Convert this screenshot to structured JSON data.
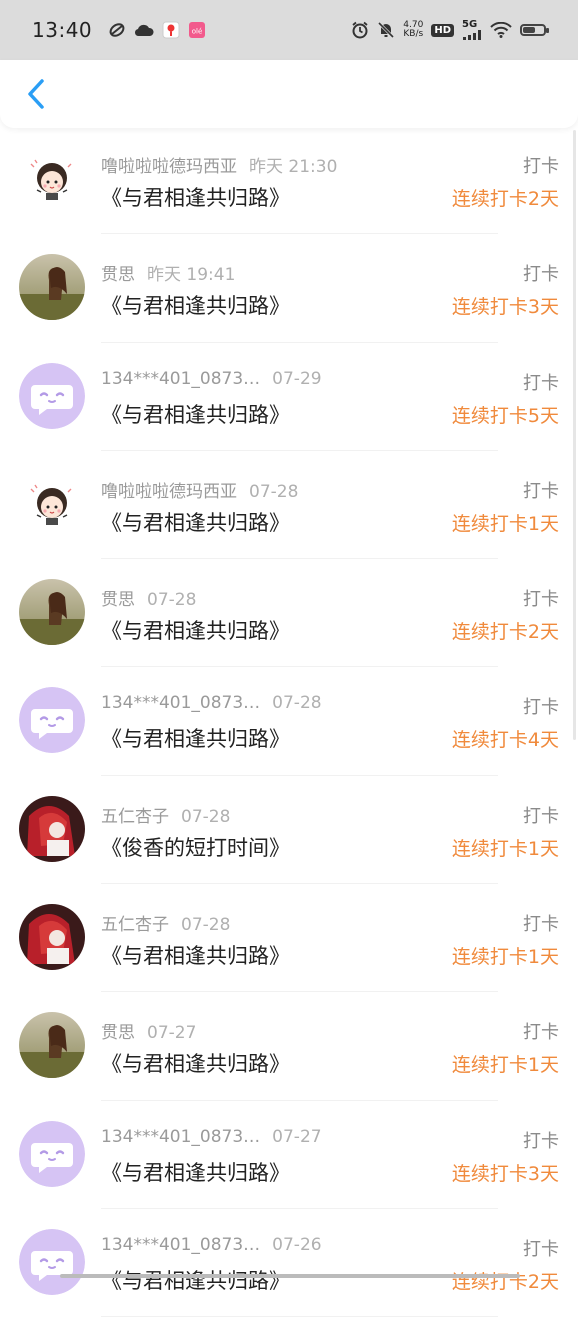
{
  "status_bar": {
    "time": "13:40",
    "net_speed_value": "4.70",
    "net_speed_unit": "KB/s",
    "hd_label": "HD",
    "network_label": "5G",
    "icons": [
      "sync-icon",
      "cloud-icon",
      "location-app-icon",
      "ole-app-icon",
      "alarm-icon",
      "mute-icon",
      "signal-icon",
      "wifi-icon",
      "battery-icon"
    ]
  },
  "header": {
    "back_icon": "chevron-left-icon",
    "accent_color": "#2a9ef5"
  },
  "colors": {
    "streak": "#f08a3c",
    "avatar_placeholder": "#d6c4f4"
  },
  "rows": [
    {
      "name": "噜啦啦啦德玛西亚",
      "time": "昨天 21:30",
      "title": "《与君相逢共归路》",
      "action": "打卡",
      "streak": "连续打卡2天",
      "avatar": "cartoon-girl-avatar"
    },
    {
      "name": "贯思",
      "time": "昨天 19:41",
      "title": "《与君相逢共归路》",
      "action": "打卡",
      "streak": "连续打卡3天",
      "avatar": "landscape-photo-avatar"
    },
    {
      "name": "134***401_0873…",
      "time": "07-29",
      "title": "《与君相逢共归路》",
      "action": "打卡",
      "streak": "连续打卡5天",
      "avatar": "default-chat-avatar"
    },
    {
      "name": "噜啦啦啦德玛西亚",
      "time": "07-28",
      "title": "《与君相逢共归路》",
      "action": "打卡",
      "streak": "连续打卡1天",
      "avatar": "cartoon-girl-avatar"
    },
    {
      "name": "贯思",
      "time": "07-28",
      "title": "《与君相逢共归路》",
      "action": "打卡",
      "streak": "连续打卡2天",
      "avatar": "landscape-photo-avatar"
    },
    {
      "name": "134***401_0873…",
      "time": "07-28",
      "title": "《与君相逢共归路》",
      "action": "打卡",
      "streak": "连续打卡4天",
      "avatar": "default-chat-avatar"
    },
    {
      "name": "五仁杏子",
      "time": "07-28",
      "title": "《俊香的短打时间》",
      "action": "打卡",
      "streak": "连续打卡1天",
      "avatar": "red-hair-photo-avatar"
    },
    {
      "name": "五仁杏子",
      "time": "07-28",
      "title": "《与君相逢共归路》",
      "action": "打卡",
      "streak": "连续打卡1天",
      "avatar": "red-hair-photo-avatar"
    },
    {
      "name": "贯思",
      "time": "07-27",
      "title": "《与君相逢共归路》",
      "action": "打卡",
      "streak": "连续打卡1天",
      "avatar": "landscape-photo-avatar"
    },
    {
      "name": "134***401_0873…",
      "time": "07-27",
      "title": "《与君相逢共归路》",
      "action": "打卡",
      "streak": "连续打卡3天",
      "avatar": "default-chat-avatar"
    },
    {
      "name": "134***401_0873…",
      "time": "07-26",
      "title": "《与君相逢共归路》",
      "action": "打卡",
      "streak": "连续打卡2天",
      "avatar": "default-chat-avatar"
    }
  ]
}
